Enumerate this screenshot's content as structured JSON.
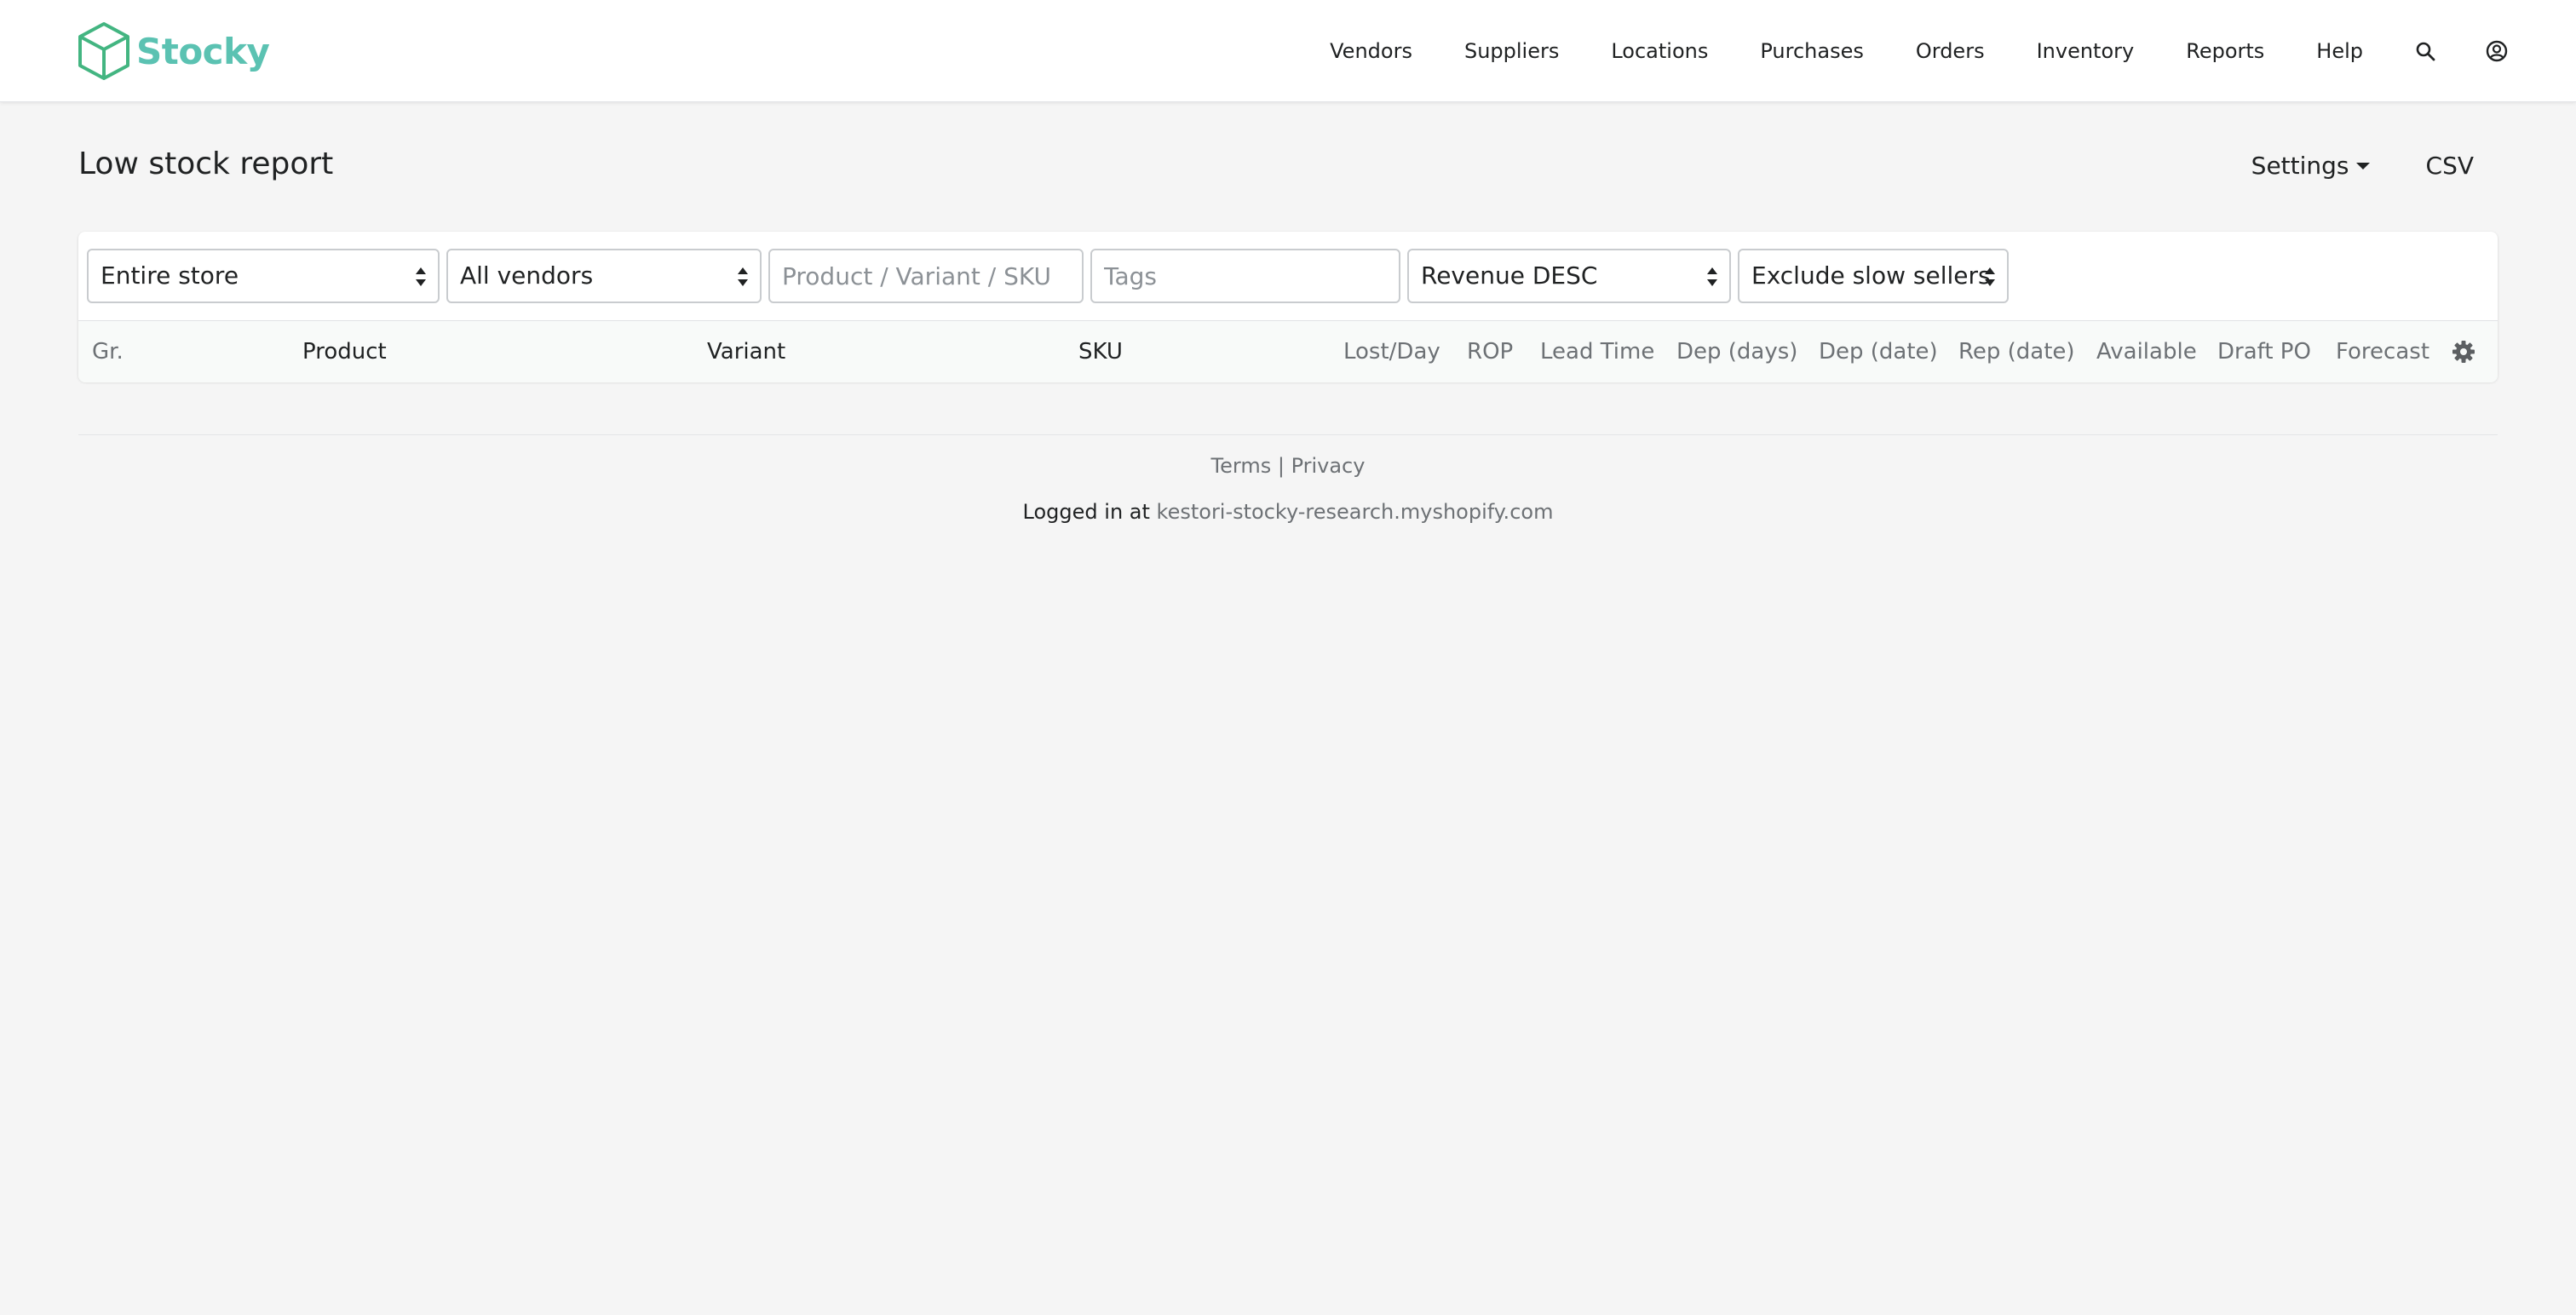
{
  "brand": {
    "name": "Stocky",
    "color": "#5bc2b2",
    "logo_color": "#43b581"
  },
  "nav": {
    "items": [
      {
        "label": "Vendors"
      },
      {
        "label": "Suppliers"
      },
      {
        "label": "Locations"
      },
      {
        "label": "Purchases"
      },
      {
        "label": "Orders"
      },
      {
        "label": "Inventory"
      },
      {
        "label": "Reports"
      },
      {
        "label": "Help"
      }
    ],
    "icons": [
      "search-icon",
      "user-circle-icon"
    ]
  },
  "page": {
    "title": "Low stock report",
    "settings_label": "Settings",
    "csv_label": "CSV"
  },
  "filters": {
    "location": {
      "value": "Entire store"
    },
    "vendor": {
      "value": "All vendors"
    },
    "product_search": {
      "placeholder": "Product / Variant / SKU",
      "value": ""
    },
    "tags": {
      "placeholder": "Tags",
      "value": ""
    },
    "sort": {
      "value": "Revenue DESC"
    },
    "sellers": {
      "value": "Exclude slow sellers"
    }
  },
  "table": {
    "columns": [
      "Gr.",
      "Product",
      "Variant",
      "SKU",
      "Lost/Day",
      "ROP",
      "Lead Time",
      "Dep (days)",
      "Dep (date)",
      "Rep (date)",
      "Available",
      "Draft PO",
      "Forecast"
    ],
    "settings_icon": "gear-icon",
    "rows": []
  },
  "footer": {
    "terms": "Terms",
    "separator": " | ",
    "privacy": "Privacy",
    "logged_in_prefix": "Logged in at ",
    "shop_domain": "kestori-stocky-research.myshopify.com"
  }
}
